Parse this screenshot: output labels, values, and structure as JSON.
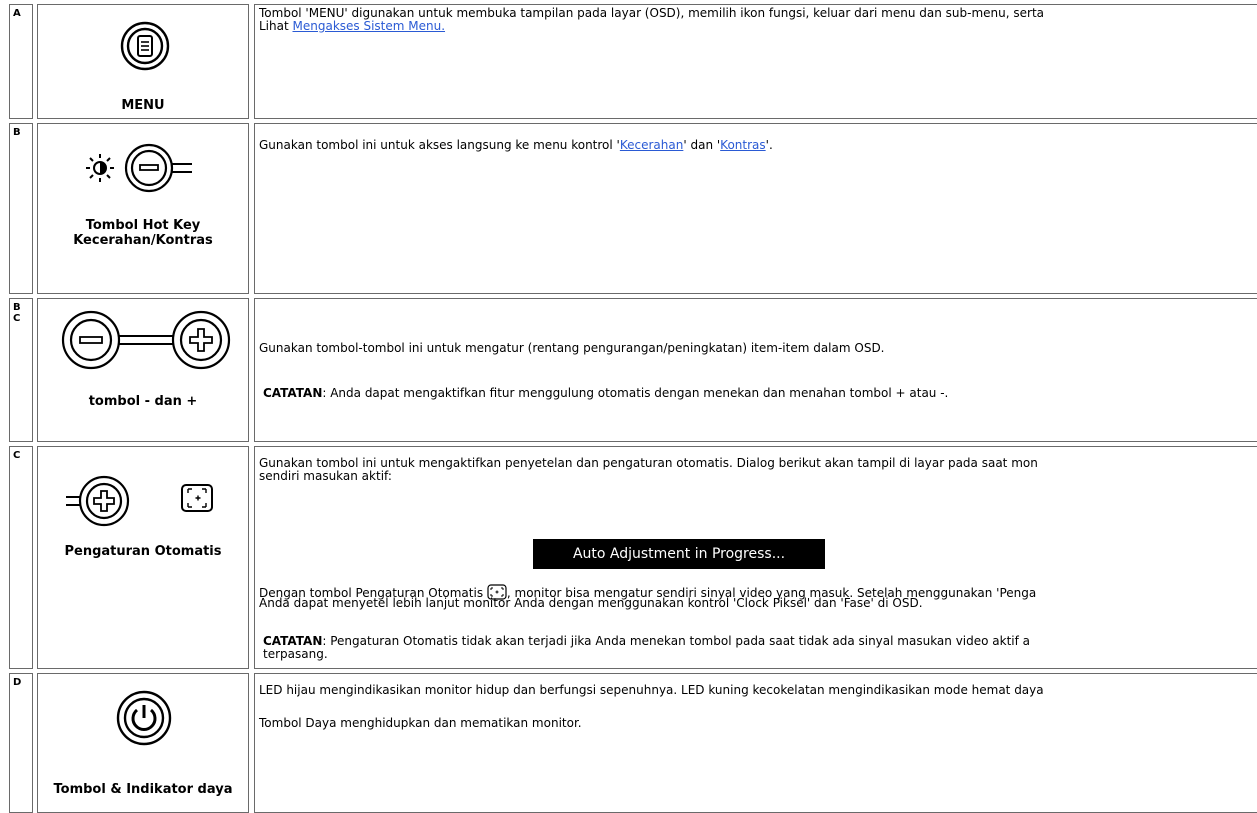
{
  "rows": [
    {
      "letter": "A",
      "label": "MENU",
      "icon": "menu-button-icon",
      "line1": "Tombol 'MENU' digunakan untuk membuka tampilan pada layar (OSD), memilih ikon fungsi, keluar dari menu dan sub-menu, serta",
      "line2_prefix": "Lihat ",
      "line2_link": "Mengakses Sistem Menu."
    },
    {
      "letter": "B",
      "label_line1": "Tombol Hot Key",
      "label_line2": "Kecerahan/Kontras",
      "icon": "brightness-minus-button-icon",
      "text_prefix": "Gunakan tombol ini untuk akses langsung ke menu kontrol '",
      "link1": "Kecerahan",
      "text_mid": "' dan '",
      "link2": "Kontras",
      "text_suffix": "'."
    },
    {
      "letter1": "B",
      "letter2": "C",
      "label": "tombol - dan +",
      "icon": "minus-plus-buttons-icon",
      "text": "Gunakan tombol-tombol ini untuk mengatur (rentang pengurangan/peningkatan) item-item dalam OSD.",
      "note_label": "CATATAN",
      "note_text": ": Anda dapat mengaktifkan fitur menggulung otomatis dengan menekan dan menahan tombol + atau -."
    },
    {
      "letter": "C",
      "label": "Pengaturan Otomatis",
      "icon": "plus-auto-adjust-icon",
      "line1": "Gunakan tombol ini untuk mengaktifkan penyetelan dan pengaturan otomatis. Dialog berikut akan tampil di layar pada saat mon",
      "line2": "sendiri masukan aktif:",
      "banner": "Auto Adjustment in Progress...",
      "para2_prefix": "Dengan tombol Pengaturan Otomatis ",
      "para2_suffix": ", monitor bisa mengatur sendiri sinyal video yang masuk. Setelah menggunakan 'Penga",
      "para2_line2": "Anda dapat menyetel lebih lanjut monitor Anda dengan menggunakan kontrol 'Clock Piksel' dan 'Fase' di OSD.",
      "note_label": "CATATAN",
      "note_text": ": Pengaturan Otomatis tidak akan terjadi jika Anda menekan tombol pada saat tidak ada sinyal masukan video aktif a",
      "note_line2": "terpasang."
    },
    {
      "letter": "D",
      "label": "Tombol & Indikator daya",
      "icon": "power-button-icon",
      "line1": "LED hijau mengindikasikan monitor hidup dan berfungsi sepenuhnya. LED kuning kecokelatan mengindikasikan mode hemat daya",
      "line2": "Tombol Daya menghidupkan dan mematikan monitor."
    }
  ],
  "colors": {
    "link": "#2a5ad4",
    "border": "#6a6a6a",
    "banner_bg": "#000000",
    "banner_text": "#ffffff"
  }
}
